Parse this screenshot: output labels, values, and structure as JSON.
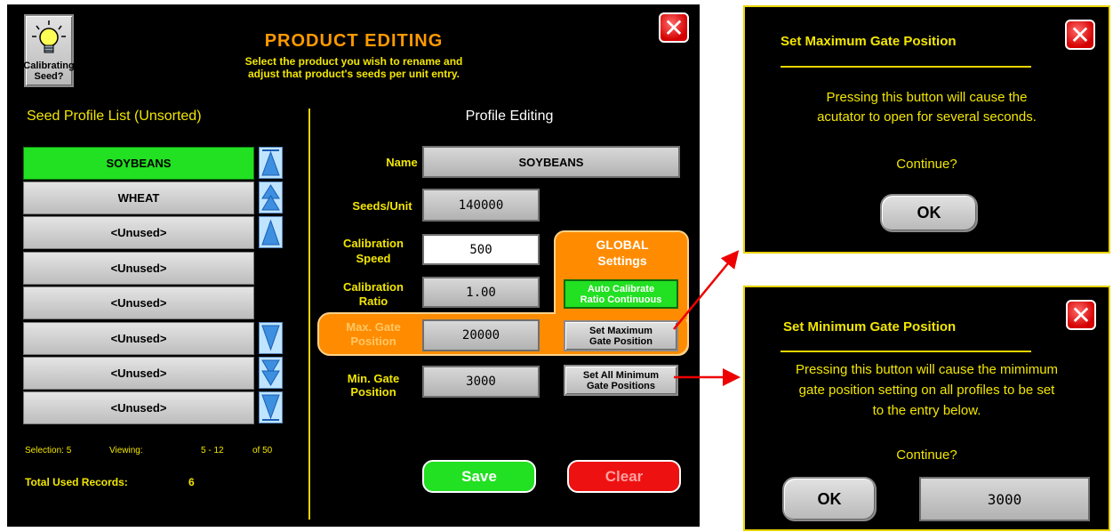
{
  "main": {
    "title": "PRODUCT EDITING",
    "subtitle_line1": "Select the product you wish to rename and",
    "subtitle_line2": "adjust that product's seeds per unit entry.",
    "calibrating_line1": "Calibrating",
    "calibrating_line2": "Seed?",
    "close_glyph": "✕"
  },
  "seed_list": {
    "heading": "Seed Profile List (Unsorted)",
    "items": [
      "SOYBEANS",
      "WHEAT",
      "<Unused>",
      "<Unused>",
      "<Unused>",
      "<Unused>",
      "<Unused>",
      "<Unused>"
    ],
    "selection_label": "Selection: 5",
    "viewing_label": "Viewing:",
    "viewing_range": "5 - 12",
    "viewing_total": "of 50",
    "total_label": "Total Used Records:",
    "total_value": "6"
  },
  "editing": {
    "heading": "Profile Editing",
    "name_label": "Name",
    "name_value": "SOYBEANS",
    "seeds_label": "Seeds/Unit",
    "seeds_value": "140000",
    "cal_speed_label1": "Calibration",
    "cal_speed_label2": "Speed",
    "cal_speed_value": "500",
    "cal_ratio_label1": "Calibration",
    "cal_ratio_label2": "Ratio",
    "cal_ratio_value": "1.00",
    "max_gate_label1": "Max. Gate",
    "max_gate_label2": "Position",
    "max_gate_value": "20000",
    "min_gate_label1": "Min. Gate",
    "min_gate_label2": "Position",
    "min_gate_value": "3000",
    "global_line1": "GLOBAL",
    "global_line2": "Settings",
    "auto_cal_line1": "Auto Calibrate",
    "auto_cal_line2": "Ratio Continuous",
    "set_max_line1": "Set Maximum",
    "set_max_line2": "Gate Position",
    "set_min_line1": "Set All Minimum",
    "set_min_line2": "Gate Positions",
    "save_label": "Save",
    "clear_label": "Clear"
  },
  "dialog_max": {
    "title": "Set Maximum Gate Position",
    "line1": "Pressing this button will cause the",
    "line2": "acutator to open for several seconds.",
    "continue": "Continue?",
    "ok": "OK"
  },
  "dialog_min": {
    "title": "Set Minimum Gate Position",
    "line1": "Pressing this button will cause the mimimum",
    "line2": "gate position setting on all profiles to be set",
    "line3": "to the entry below.",
    "continue": "Continue?",
    "ok": "OK",
    "value": "3000"
  },
  "colors": {
    "selected_row": "#22e022",
    "orange_panel": "#ff8c00",
    "label_yellow": "#f2e600",
    "save_green": "#22e022",
    "clear_red": "#ee1111"
  }
}
